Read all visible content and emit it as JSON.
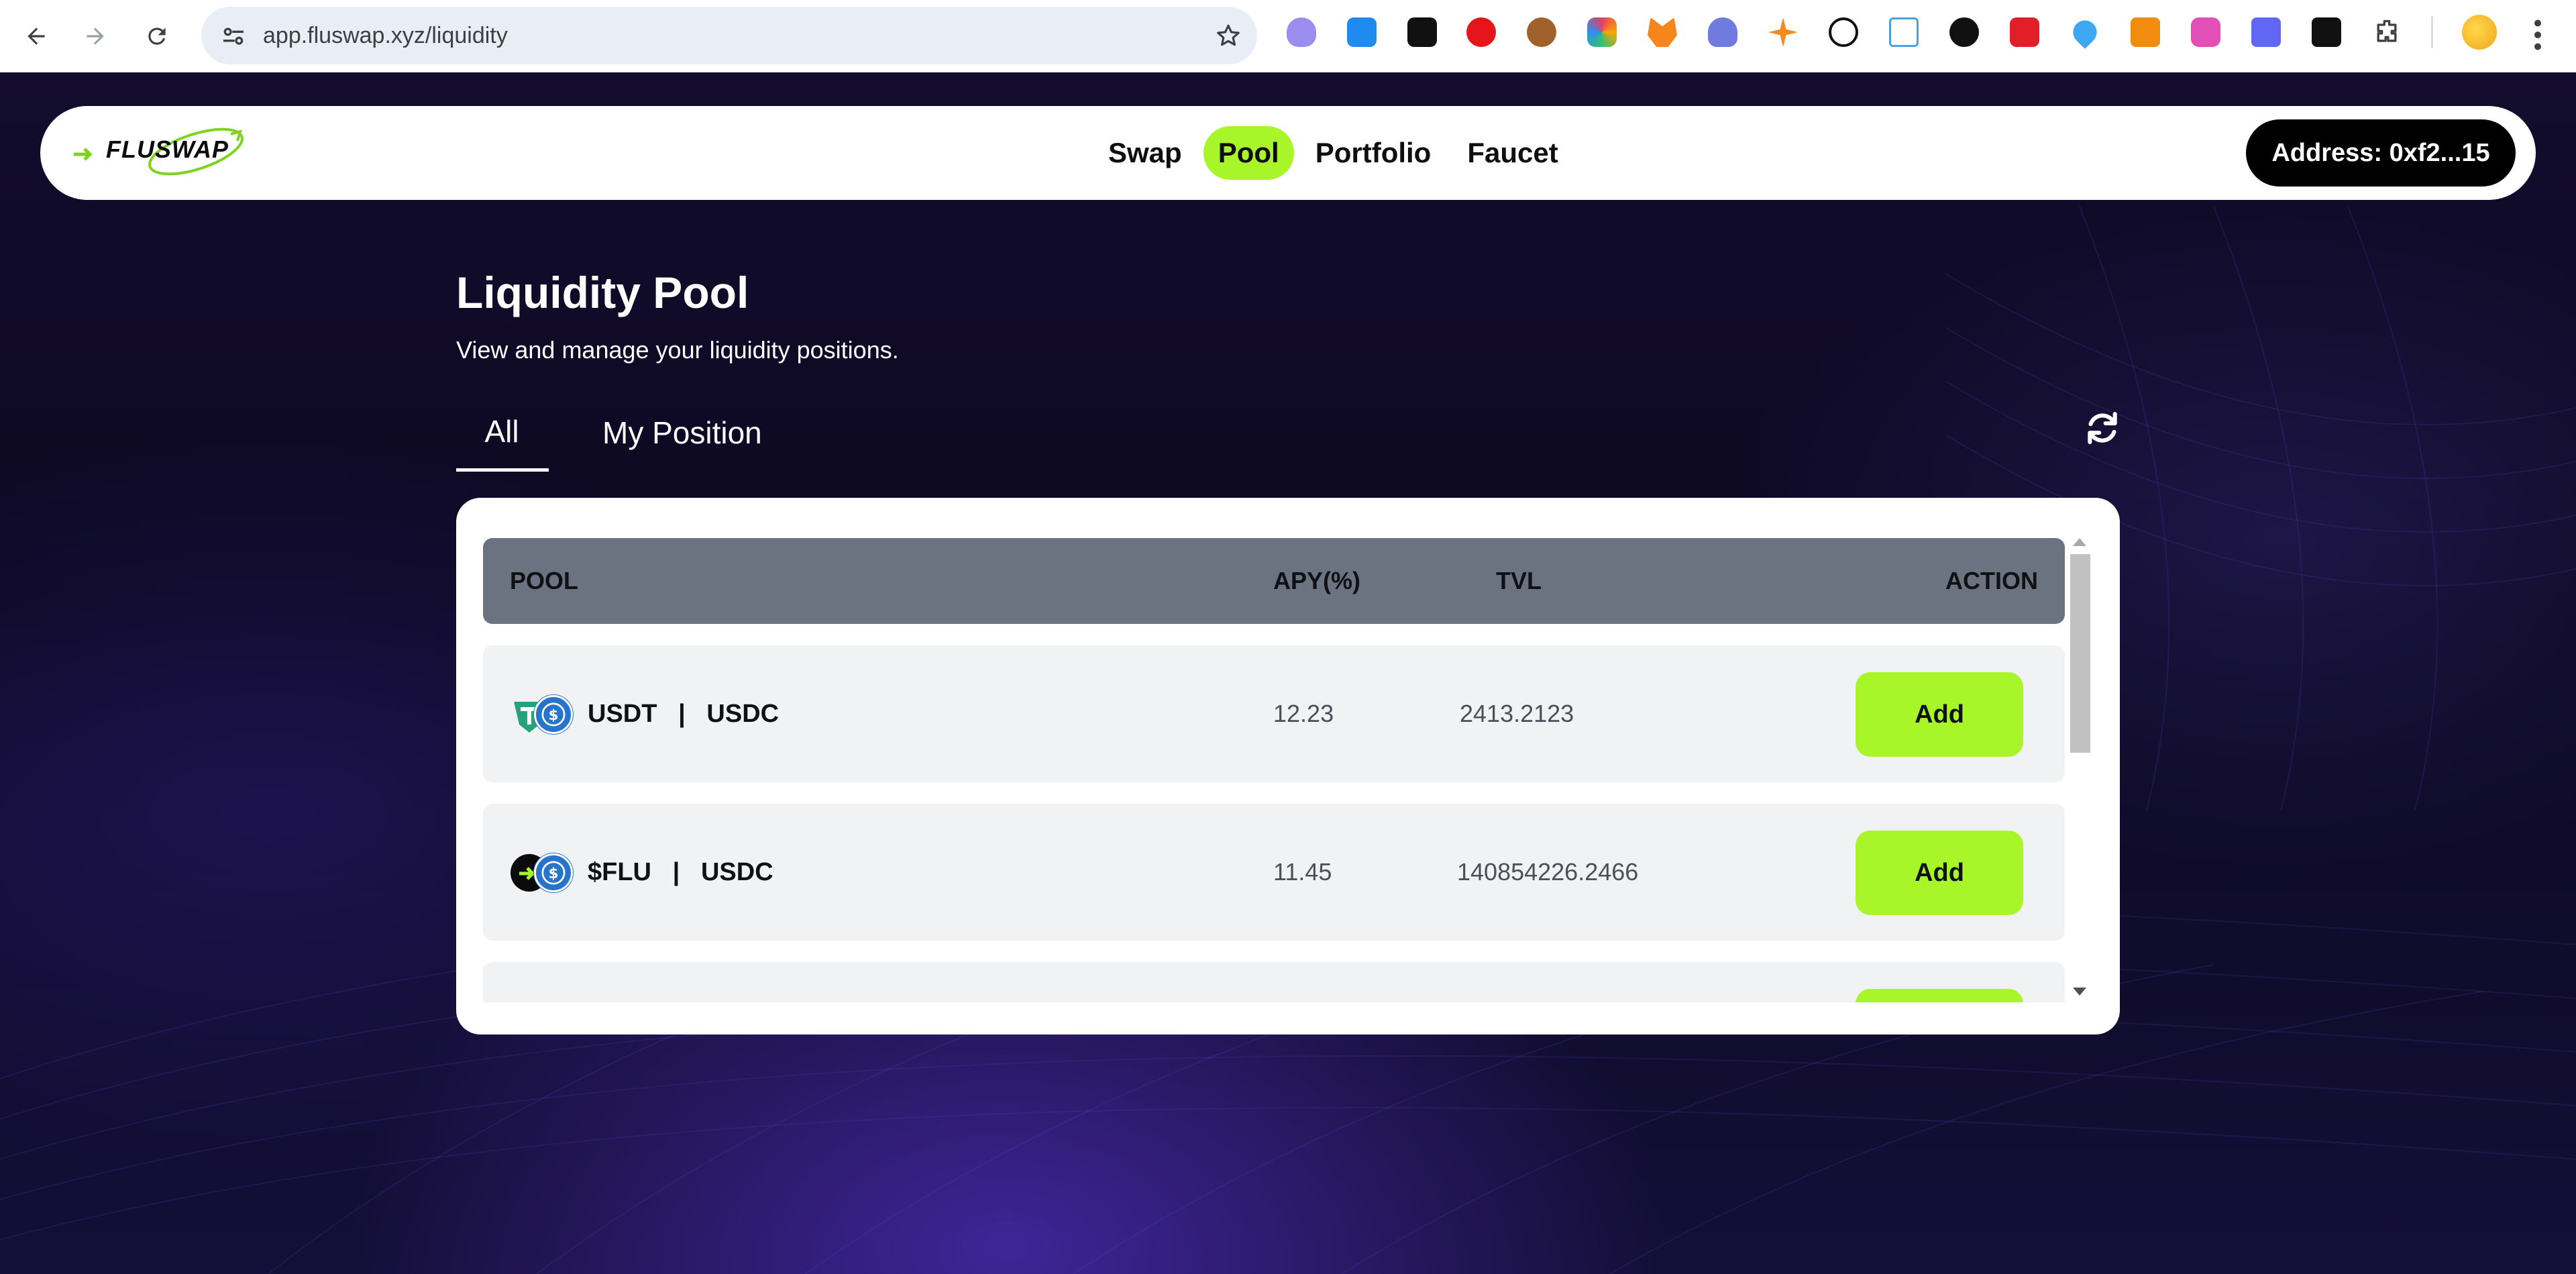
{
  "browser": {
    "url": "app.fluswap.xyz/liquidity",
    "extensions": [
      "ghost-extension-icon",
      "k-extension-icon",
      "dice-extension-icon",
      "shield-extension-icon",
      "cookie-extension-icon",
      "circle-extension-icon",
      "metamask-fox-icon",
      "rabbit-extension-icon",
      "spark-extension-icon",
      "w-extension-icon",
      "t-extension-icon",
      "info-extension-icon",
      "gear-red-extension-icon",
      "drop-extension-icon",
      "orange-extension-icon",
      "pink-extension-icon",
      "cat-extension-icon",
      "slash-extension-icon",
      "puzzle-extensions-icon"
    ]
  },
  "app": {
    "logo_text": "FLUSWAP",
    "nav": [
      "Swap",
      "Pool",
      "Portfolio",
      "Faucet"
    ],
    "active_nav": "Pool",
    "address_label": "Address: 0xf2...15"
  },
  "page": {
    "title": "Liquidity Pool",
    "subtitle": "View and manage your liquidity positions.",
    "tabs": [
      "All",
      "My Position"
    ],
    "active_tab": "All"
  },
  "table": {
    "headers": {
      "pool": "POOL",
      "apy": "APY(%)",
      "tvl": "TVL",
      "action": "ACTION"
    },
    "rows": [
      {
        "pair": "USDT   |   USDC",
        "apy": "12.23",
        "tvl": "2413.2123",
        "action": "Add"
      },
      {
        "pair": "$FLU   |   USDC",
        "apy": "11.45",
        "tvl": "140854226.2466",
        "action": "Add"
      }
    ]
  },
  "colors": {
    "accent": "#a8f52a",
    "header_bg": "#6b7280",
    "row_bg": "#f1f2f4",
    "usdc_blue": "#2775ca",
    "usdt_green": "#26a17b"
  }
}
